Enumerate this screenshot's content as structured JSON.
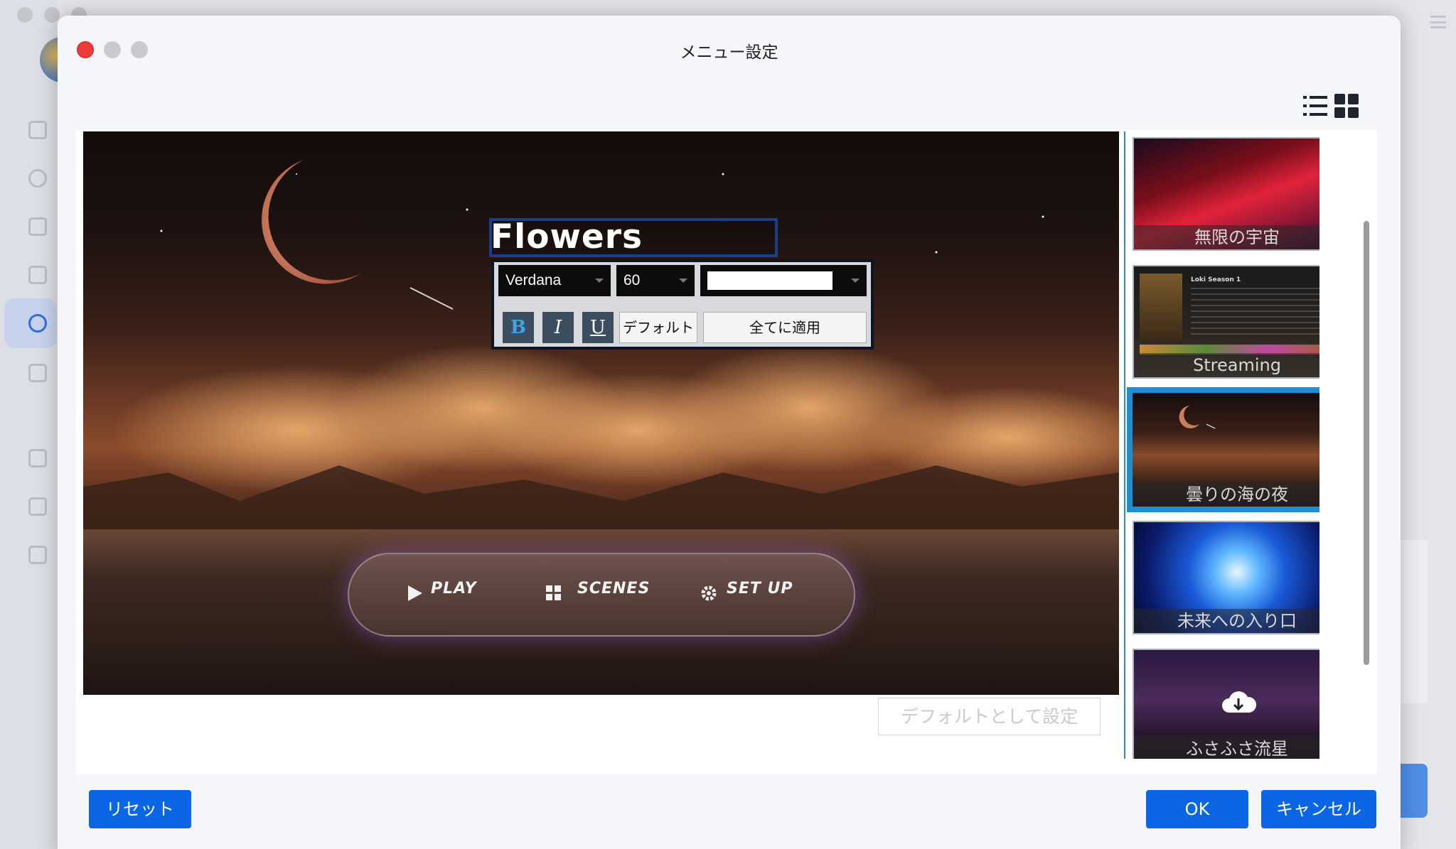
{
  "dialog": {
    "title": "メニュー設定"
  },
  "view_toggle": {
    "list_icon": "list-icon",
    "grid_icon": "grid-icon"
  },
  "preview": {
    "title_text": "Flowers",
    "font_family": "Verdana",
    "font_size": "60",
    "text_color": "#ffffff",
    "bold_label": "B",
    "italic_label": "I",
    "underline_label": "U",
    "default_label": "デフォルト",
    "apply_all_label": "全てに適用",
    "menu_items": [
      "PLAY",
      "SCENES",
      "SET UP"
    ],
    "set_default_label": "デフォルトとして設定"
  },
  "templates": [
    {
      "label": "無限の宇宙"
    },
    {
      "label": "Streaming"
    },
    {
      "label": "曇りの海の夜",
      "selected": true
    },
    {
      "label": "未来への入り口"
    },
    {
      "label": "ふさふさ流星",
      "download": true
    }
  ],
  "streaming_thumb": {
    "heading": "Loki Season 1"
  },
  "footer": {
    "reset_label": "リセット",
    "ok_label": "OK",
    "cancel_label": "キャンセル"
  },
  "colors": {
    "accent": "#0a66e4",
    "selection": "#1a8fd6",
    "close": "#ed3b3b"
  }
}
